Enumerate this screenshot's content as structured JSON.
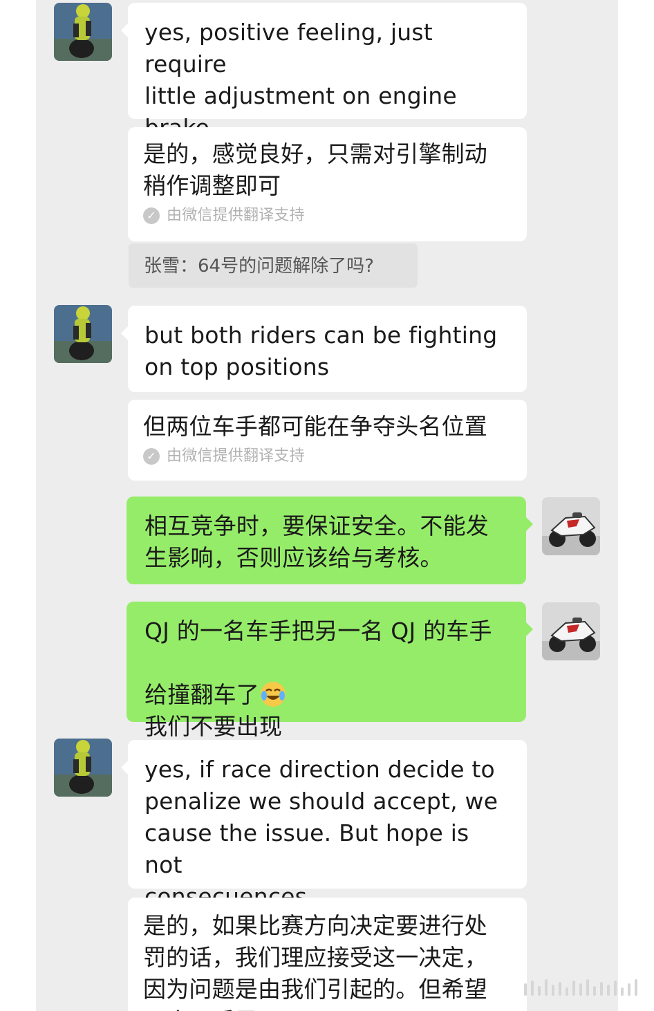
{
  "conversation": {
    "messages": [
      {
        "sender": "rider",
        "avatar_icon": "rider-avatar-icon",
        "text": "yes, positive feeling, just require\nlittle adjustment on engine\nbrake",
        "translation": "是的，感觉良好，只需对引擎制动\n稍作调整即可",
        "translation_note": "由微信提供翻译支持"
      },
      {
        "type": "quote",
        "text": "张雪：64号的问题解除了吗?"
      },
      {
        "sender": "rider",
        "avatar_icon": "rider-avatar-icon",
        "text": "but both riders can be fighting\non top positions",
        "translation": "但两位车手都可能在争夺头名位置",
        "translation_note": "由微信提供翻译支持"
      },
      {
        "sender": "self",
        "avatar_icon": "motorcycle-avatar-icon",
        "text": "相互竞争时，要保证安全。不能发\n生影响，否则应该给与考核。"
      },
      {
        "sender": "self",
        "avatar_icon": "motorcycle-avatar-icon",
        "text_line1": "QJ 的一名车手把另一名 QJ 的车手",
        "text_line2": "给撞翻车了",
        "emoji": "crying-laughing-emoji-icon",
        "text_line3": "我们不要出现"
      },
      {
        "sender": "rider",
        "avatar_icon": "rider-avatar-icon",
        "text": "yes, if race direction decide to\npenalize we should accept, we\ncause the issue. But hope is not\nconsecuences",
        "translation": "是的，如果比赛方向决定要进行处\n罚的话，我们理应接受这一决定，\n因为问题是由我们引起的。但希望\n不会下后果"
      }
    ]
  },
  "colors": {
    "chat_background": "#ededed",
    "incoming_bubble": "#ffffff",
    "outgoing_bubble": "#95ec69",
    "translation_note": "#b2b2b2"
  }
}
